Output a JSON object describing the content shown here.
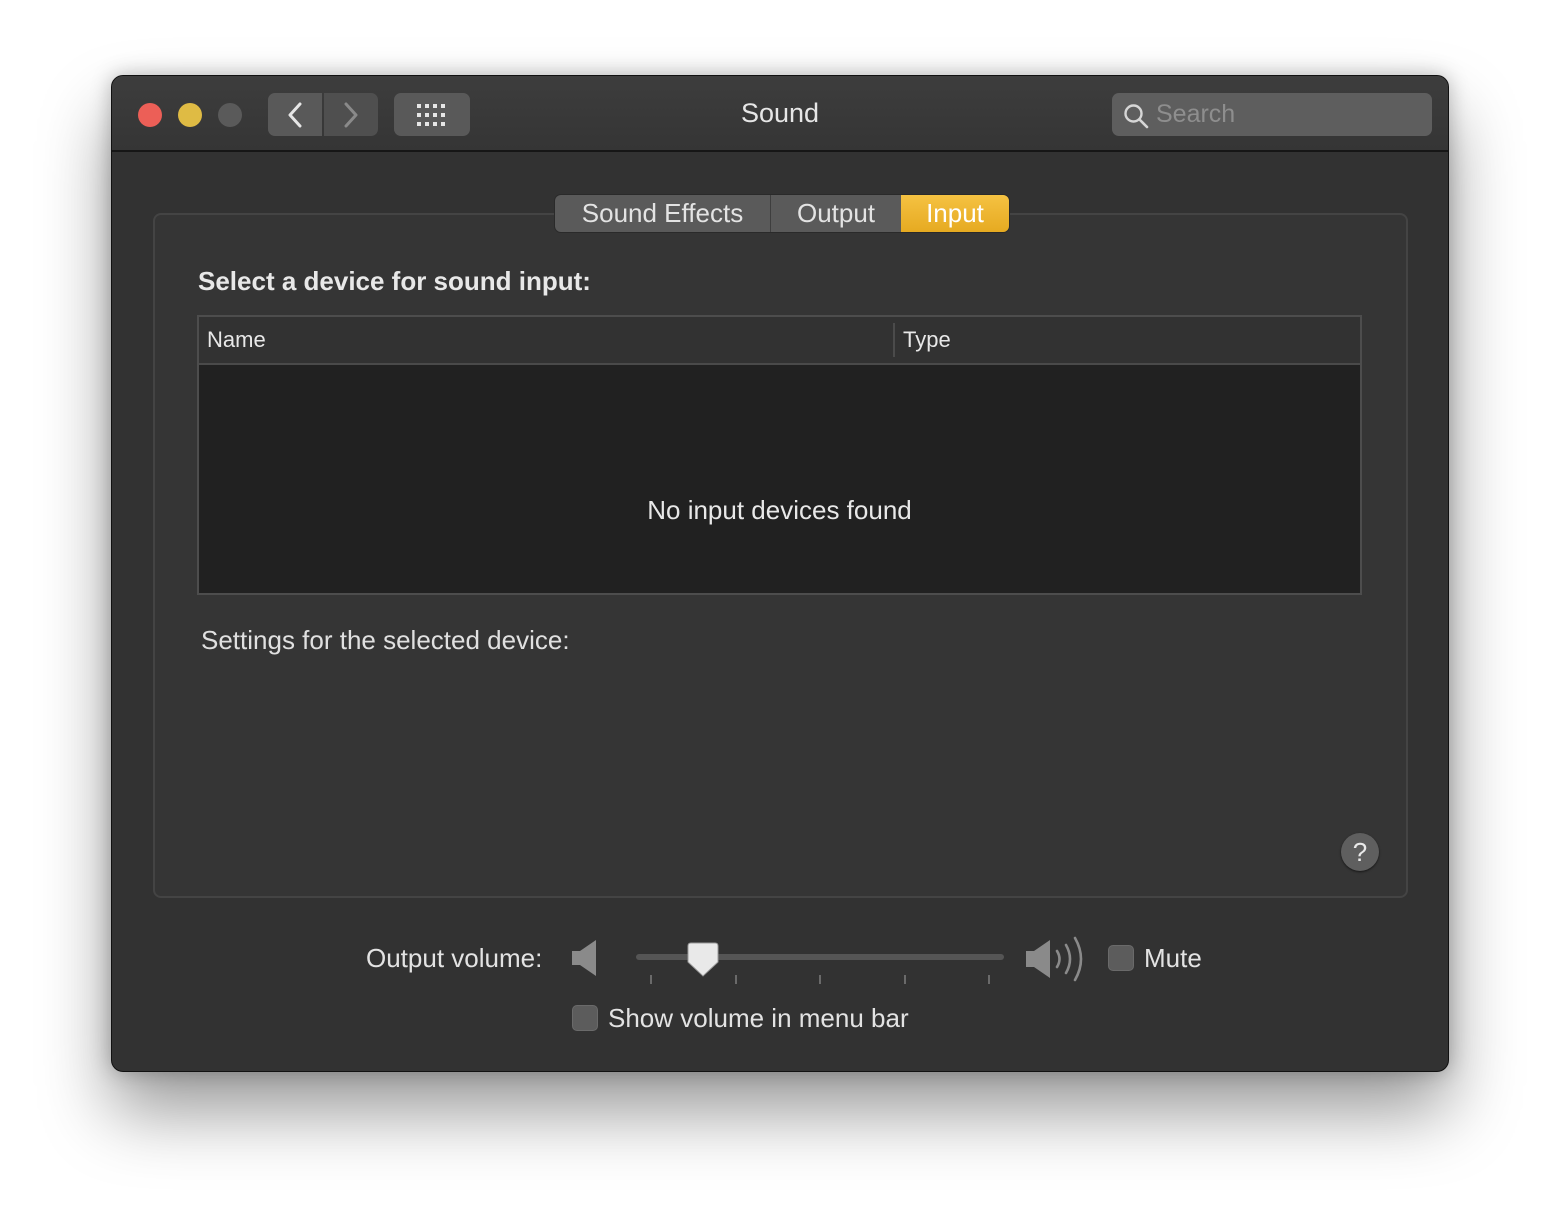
{
  "window": {
    "title": "Sound"
  },
  "toolbar": {
    "back_icon": "chevron-left-icon",
    "forward_icon": "chevron-right-icon",
    "show_all_icon": "grid-icon"
  },
  "search": {
    "placeholder": "Search",
    "value": ""
  },
  "tabs": [
    {
      "label": "Sound Effects",
      "selected": false
    },
    {
      "label": "Output",
      "selected": false
    },
    {
      "label": "Input",
      "selected": true
    }
  ],
  "input": {
    "heading": "Select a device for sound input:",
    "columns": [
      "Name",
      "Type"
    ],
    "rows": [],
    "empty_message": "No input devices found",
    "settings_label": "Settings for the selected device:"
  },
  "help": {
    "label": "?"
  },
  "output_volume": {
    "label": "Output volume:",
    "level": 0.14,
    "tick_count": 5
  },
  "mute": {
    "label": "Mute",
    "checked": false
  },
  "menu_bar": {
    "label": "Show volume in menu bar",
    "checked": false
  },
  "colors": {
    "accent": "#f0b93a",
    "close": "#ec5f57",
    "minimize": "#dfbb44",
    "zoom_disabled": "#5a5a5a",
    "window_bg": "#323232"
  }
}
